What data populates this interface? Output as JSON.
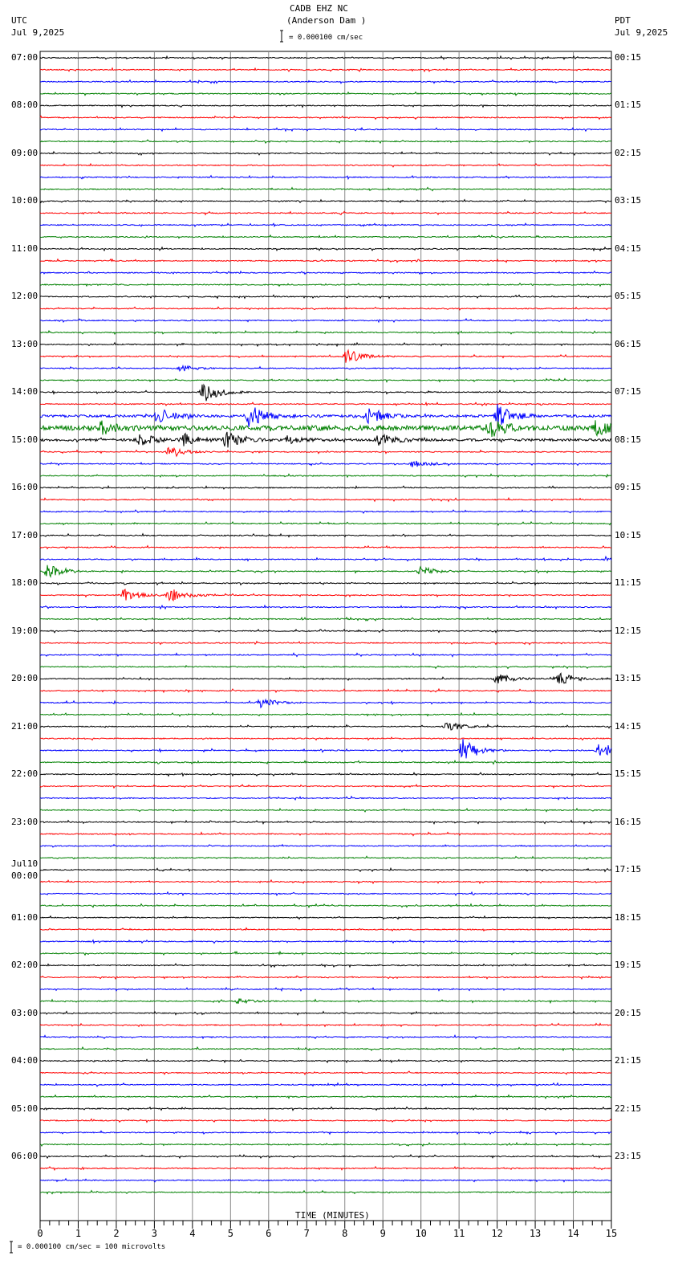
{
  "header": {
    "station": "CADB EHZ NC",
    "location": "(Anderson Dam )",
    "left_tz": "UTC",
    "left_date": "Jul 9,2025",
    "right_tz": "PDT",
    "right_date": "Jul 9,2025",
    "scale": "= 0.000100 cm/sec"
  },
  "footer": {
    "scale": "= 0.000100 cm/sec =     100 microvolts"
  },
  "chart_data": {
    "type": "line",
    "title": "CADB EHZ NC (Anderson Dam )",
    "xlabel": "TIME (MINUTES)",
    "xlim": [
      0,
      15
    ],
    "xticks": [
      "0",
      "1",
      "2",
      "3",
      "4",
      "5",
      "6",
      "7",
      "8",
      "9",
      "10",
      "11",
      "12",
      "13",
      "14",
      "15"
    ],
    "trace_minutes": 15,
    "trace_count": 96,
    "colors": [
      "#000000",
      "#ff0000",
      "#0000ff",
      "#008000"
    ],
    "left_labels": [
      "07:00",
      "08:00",
      "09:00",
      "10:00",
      "11:00",
      "12:00",
      "13:00",
      "14:00",
      "15:00",
      "16:00",
      "17:00",
      "18:00",
      "19:00",
      "20:00",
      "21:00",
      "22:00",
      "23:00",
      "Jul10 00:00",
      "01:00",
      "02:00",
      "03:00",
      "04:00",
      "05:00",
      "06:00"
    ],
    "right_labels": [
      "00:15",
      "01:15",
      "02:15",
      "03:15",
      "04:15",
      "05:15",
      "06:15",
      "07:15",
      "08:15",
      "09:15",
      "10:15",
      "11:15",
      "12:15",
      "13:15",
      "14:15",
      "15:15",
      "16:15",
      "17:15",
      "18:15",
      "19:15",
      "20:15",
      "21:15",
      "22:15",
      "23:15"
    ],
    "events": [
      {
        "trace": 25,
        "minute": 8.05,
        "amp": 10
      },
      {
        "trace": 26,
        "minute": 3.7,
        "amp": 4
      },
      {
        "trace": 28,
        "minute": 4.3,
        "amp": 14
      },
      {
        "trace": 30,
        "minute": 3.0,
        "amp": 10
      },
      {
        "trace": 30,
        "minute": 5.5,
        "amp": 14
      },
      {
        "trace": 30,
        "minute": 8.6,
        "amp": 10
      },
      {
        "trace": 30,
        "minute": 12.0,
        "amp": 16
      },
      {
        "trace": 31,
        "minute": 1.6,
        "amp": 7
      },
      {
        "trace": 31,
        "minute": 11.8,
        "amp": 12
      },
      {
        "trace": 31,
        "minute": 14.6,
        "amp": 8
      },
      {
        "trace": 32,
        "minute": 2.6,
        "amp": 9
      },
      {
        "trace": 32,
        "minute": 3.8,
        "amp": 7
      },
      {
        "trace": 32,
        "minute": 4.9,
        "amp": 10
      },
      {
        "trace": 32,
        "minute": 6.5,
        "amp": 5
      },
      {
        "trace": 32,
        "minute": 8.9,
        "amp": 8
      },
      {
        "trace": 33,
        "minute": 3.4,
        "amp": 6
      },
      {
        "trace": 34,
        "minute": 9.8,
        "amp": 6
      },
      {
        "trace": 42,
        "minute": 14.9,
        "amp": 4
      },
      {
        "trace": 43,
        "minute": 0.2,
        "amp": 9
      },
      {
        "trace": 43,
        "minute": 10.0,
        "amp": 6
      },
      {
        "trace": 45,
        "minute": 2.2,
        "amp": 8
      },
      {
        "trace": 45,
        "minute": 3.4,
        "amp": 9
      },
      {
        "trace": 52,
        "minute": 12.0,
        "amp": 7
      },
      {
        "trace": 52,
        "minute": 13.6,
        "amp": 9
      },
      {
        "trace": 54,
        "minute": 5.8,
        "amp": 6
      },
      {
        "trace": 56,
        "minute": 10.7,
        "amp": 6
      },
      {
        "trace": 58,
        "minute": 11.1,
        "amp": 14
      },
      {
        "trace": 58,
        "minute": 14.7,
        "amp": 11
      },
      {
        "trace": 79,
        "minute": 5.2,
        "amp": 3
      }
    ]
  }
}
